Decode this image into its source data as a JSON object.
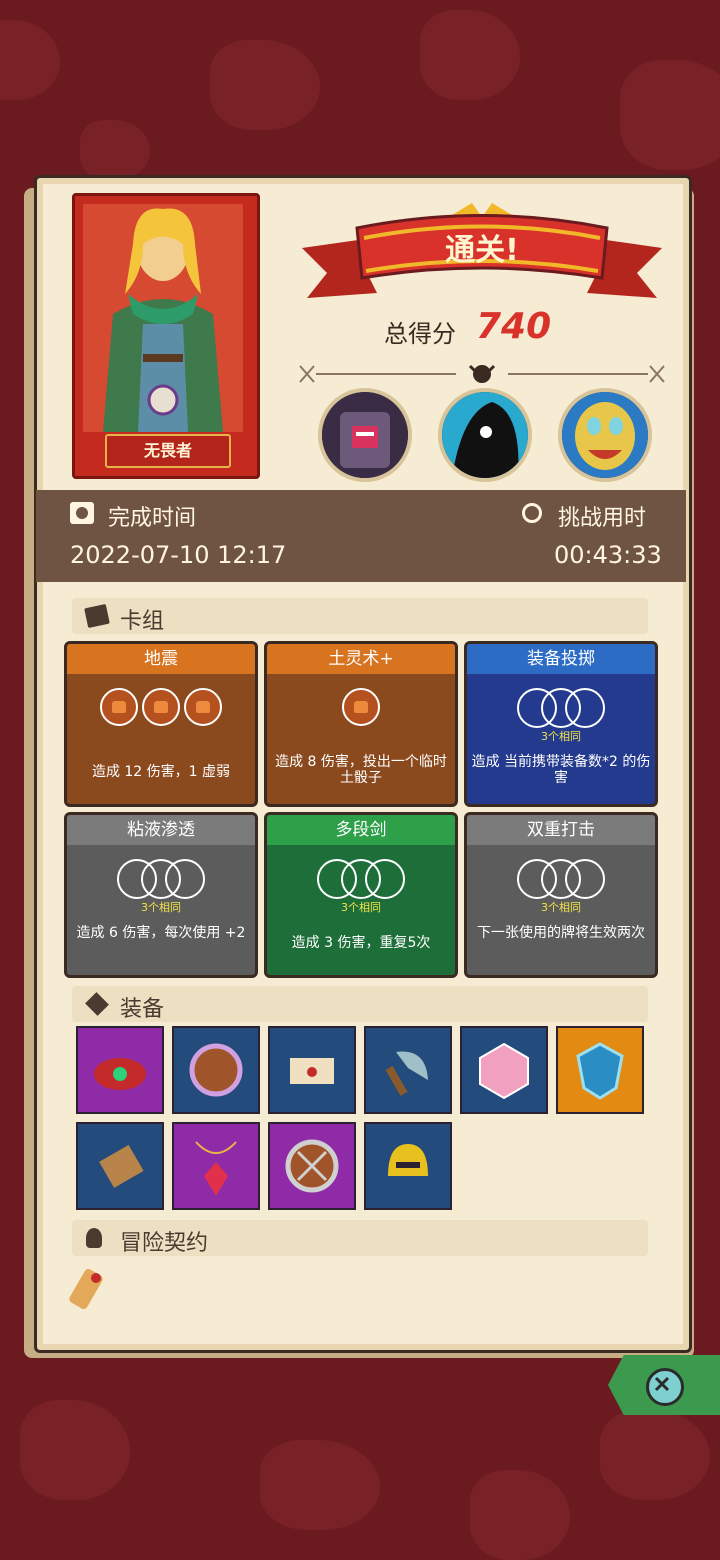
{
  "result": {
    "title": "通关!",
    "score_label": "总得分",
    "score_value": "740"
  },
  "hero": {
    "name": "无畏者"
  },
  "time": {
    "completed_label": "完成时间",
    "completed_value": "2022-07-10 12:17",
    "challenge_label": "挑战用时",
    "challenge_value": "00:43:33"
  },
  "sections": {
    "deck": "卡组",
    "equipment": "装备",
    "contract": "冒险契约"
  },
  "cards": [
    {
      "name": "地震",
      "color": "#d8731f",
      "body": "#8b4a1e",
      "desc": "造成 12 伤害，1 虚弱",
      "type": "dice3"
    },
    {
      "name": "土灵术+",
      "color": "#d8731f",
      "body": "#8b4a1e",
      "desc": "造成 8 伤害，投出一个临时土骰子",
      "type": "dice1"
    },
    {
      "name": "装备投掷",
      "color": "#2d6cc4",
      "body": "#233a8e",
      "desc": "造成 当前携带装备数*2 的伤害",
      "same": "3个相同",
      "type": "circles"
    },
    {
      "name": "粘液渗透",
      "color": "#7b7b7b",
      "body": "#5c5c5c",
      "desc": "造成 6 伤害，每次使用 +2",
      "same": "3个相同",
      "type": "circles"
    },
    {
      "name": "多段剑",
      "color": "#2fa04a",
      "body": "#1e6e3a",
      "desc": "造成 3 伤害，重复5次",
      "same": "3个相同",
      "type": "circles"
    },
    {
      "name": "双重打击",
      "color": "#7b7b7b",
      "body": "#5c5c5c",
      "desc": "下一张使用的牌将生效两次",
      "same": "3个相同",
      "type": "circles"
    }
  ],
  "equipment": [
    {
      "icon": "red-bracelet-icon",
      "bg": "#8f2ba6"
    },
    {
      "icon": "round-shield-icon",
      "bg": "#234b7c"
    },
    {
      "icon": "scroll-icon",
      "bg": "#234b7c"
    },
    {
      "icon": "axe-icon",
      "bg": "#234b7c"
    },
    {
      "icon": "crystal-d20-icon",
      "bg": "#234b7c"
    },
    {
      "icon": "blue-shield-icon",
      "bg": "#e38a12"
    },
    {
      "icon": "bracer-icon",
      "bg": "#234b7c"
    },
    {
      "icon": "ruby-pendant-icon",
      "bg": "#8f2ba6"
    },
    {
      "icon": "wooden-shield-icon",
      "bg": "#8f2ba6"
    },
    {
      "icon": "golden-helmet-icon",
      "bg": "#234b7c"
    }
  ]
}
